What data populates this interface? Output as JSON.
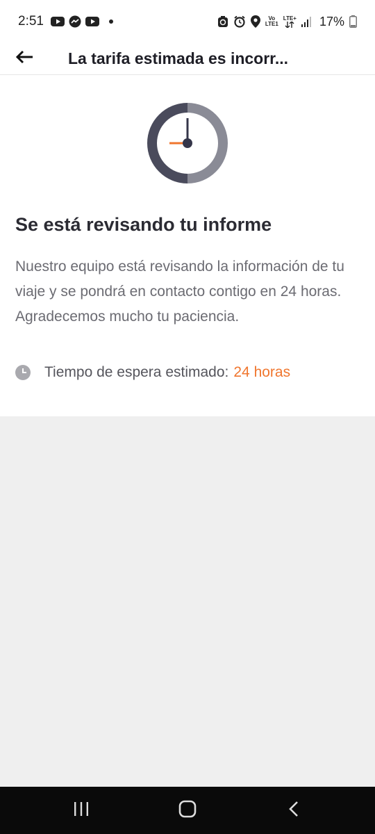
{
  "status_bar": {
    "time": "2:51",
    "battery": "17%",
    "network_top": "LTE+",
    "volte": "Vo",
    "volte_sub": "LTE1"
  },
  "header": {
    "title": "La tarifa estimada es incorr..."
  },
  "content": {
    "title": "Se está revisando tu informe",
    "body": "Nuestro equipo está revisando la información de tu viaje y se pondrá en contacto contigo en 24 horas. Agradecemos mucho tu paciencia.",
    "wait_label": "Tiempo de espera estimado:",
    "wait_value": "24 horas"
  },
  "colors": {
    "accent": "#f0762e",
    "clock_dark": "#4a4b5c",
    "clock_light": "#8a8b96",
    "background": "#efefef"
  },
  "icons": {
    "back": "arrow-left-icon",
    "clock": "clock-icon",
    "nav_recents": "recents-icon",
    "nav_home": "home-icon",
    "nav_back": "chevron-left-icon"
  }
}
